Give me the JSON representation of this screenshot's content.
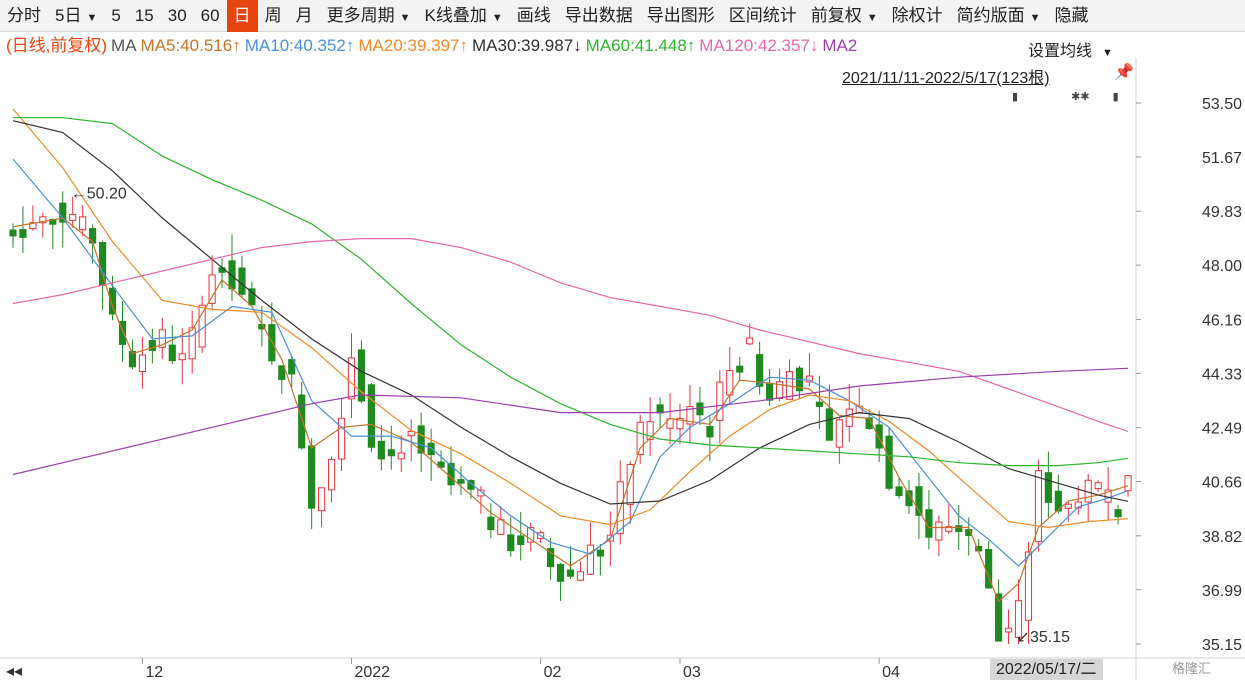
{
  "toolbar": {
    "items": [
      {
        "label": "分时",
        "dropdown": false,
        "active": false
      },
      {
        "label": "5日",
        "dropdown": true,
        "active": false
      },
      {
        "label": "5",
        "dropdown": false,
        "active": false
      },
      {
        "label": "15",
        "dropdown": false,
        "active": false
      },
      {
        "label": "30",
        "dropdown": false,
        "active": false
      },
      {
        "label": "60",
        "dropdown": false,
        "active": false
      },
      {
        "label": "日",
        "dropdown": false,
        "active": true
      },
      {
        "label": "周",
        "dropdown": false,
        "active": false
      },
      {
        "label": "月",
        "dropdown": false,
        "active": false
      },
      {
        "label": "更多周期",
        "dropdown": true,
        "active": false
      },
      {
        "label": "K线叠加",
        "dropdown": true,
        "active": false
      },
      {
        "label": "画线",
        "dropdown": false,
        "active": false
      },
      {
        "label": "导出数据",
        "dropdown": false,
        "active": false
      },
      {
        "label": "导出图形",
        "dropdown": false,
        "active": false
      },
      {
        "label": "区间统计",
        "dropdown": false,
        "active": false
      },
      {
        "label": "前复权",
        "dropdown": true,
        "active": false
      },
      {
        "label": "除权计",
        "dropdown": false,
        "active": false
      },
      {
        "label": "简约版面",
        "dropdown": true,
        "active": false
      },
      {
        "label": "隐藏",
        "dropdown": false,
        "active": false
      }
    ]
  },
  "legend": [
    {
      "text": "(日线,前复权)",
      "color": "#e6450f"
    },
    {
      "text": "MA",
      "color": "#555555"
    },
    {
      "text": "MA5:40.516↑",
      "color": "#c8742a"
    },
    {
      "text": "MA10:40.352↑",
      "color": "#4a90d9"
    },
    {
      "text": "MA20:39.397↑",
      "color": "#f08c28"
    },
    {
      "text": "MA30:39.987↓",
      "color": "#333333"
    },
    {
      "text": "MA60:41.448↑",
      "color": "#2db52d"
    },
    {
      "text": "MA120:42.357↓",
      "color": "#e868a8"
    },
    {
      "text": "MA2",
      "color": "#9b3fae"
    }
  ],
  "settings_label": "设置均线",
  "range_label": "2021/11/11-2022/5/17(123根)",
  "pin_icon": "pushpin-icon",
  "date_badge": "2022/05/17/二",
  "watermark": "格隆汇",
  "colors": {
    "up": "#e8333a",
    "down": "#1f8a1f",
    "ma5": "#c8742a",
    "ma10": "#4a90d9",
    "ma20": "#f08c28",
    "ma30": "#333333",
    "ma60": "#2db52d",
    "ma120": "#e868a8",
    "ma250": "#9b3fae"
  },
  "chart_data": {
    "type": "candlestick",
    "y_ticks": [
      "53.50",
      "51.67",
      "49.83",
      "48.00",
      "46.16",
      "44.33",
      "42.49",
      "40.66",
      "38.82",
      "36.99",
      "35.15"
    ],
    "ylim": [
      35.15,
      53.5
    ],
    "x_ticks": [
      {
        "label": "12",
        "index": 13
      },
      {
        "label": "2022",
        "index": 34
      },
      {
        "label": "02",
        "index": 53
      },
      {
        "label": "03",
        "index": 67
      },
      {
        "label": "04",
        "index": 87
      }
    ],
    "annotations": [
      {
        "text": "50.20",
        "index": 5,
        "value": 50.2,
        "pointer": "←"
      },
      {
        "text": "35.15",
        "index": 100,
        "value": 35.15,
        "pointer": "↙"
      }
    ],
    "bar_count": 113,
    "trend": [
      [
        0,
        49.2
      ],
      [
        5,
        49.8
      ],
      [
        8,
        48.9
      ],
      [
        10,
        46.0
      ],
      [
        12,
        44.8
      ],
      [
        15,
        45.5
      ],
      [
        17,
        44.5
      ],
      [
        19,
        46.8
      ],
      [
        21,
        48.2
      ],
      [
        24,
        46.3
      ],
      [
        26,
        45.0
      ],
      [
        28,
        44.0
      ],
      [
        30,
        40.0
      ],
      [
        32,
        41.5
      ],
      [
        34,
        45.0
      ],
      [
        36,
        42.2
      ],
      [
        38,
        41.5
      ],
      [
        40,
        42.2
      ],
      [
        42,
        41.2
      ],
      [
        44,
        40.5
      ],
      [
        46,
        40.2
      ],
      [
        48,
        39.3
      ],
      [
        50,
        38.6
      ],
      [
        52,
        38.8
      ],
      [
        54,
        38.0
      ],
      [
        56,
        37.4
      ],
      [
        58,
        38.3
      ],
      [
        60,
        39.0
      ],
      [
        62,
        41.5
      ],
      [
        64,
        43.0
      ],
      [
        66,
        42.6
      ],
      [
        68,
        43.3
      ],
      [
        70,
        42.5
      ],
      [
        72,
        44.8
      ],
      [
        74,
        45.0
      ],
      [
        76,
        43.4
      ],
      [
        78,
        44.4
      ],
      [
        80,
        43.8
      ],
      [
        82,
        42.0
      ],
      [
        84,
        43.3
      ],
      [
        86,
        42.8
      ],
      [
        88,
        40.8
      ],
      [
        90,
        40.2
      ],
      [
        92,
        38.9
      ],
      [
        95,
        39.3
      ],
      [
        97,
        38.4
      ],
      [
        99,
        35.3
      ],
      [
        101,
        36.2
      ],
      [
        103,
        40.7
      ],
      [
        105,
        39.8
      ],
      [
        107,
        40.2
      ],
      [
        109,
        40.4
      ],
      [
        111,
        39.9
      ],
      [
        112,
        41.3
      ]
    ],
    "ma_series": [
      {
        "key": "ma5",
        "values": [
          [
            0,
            49.3
          ],
          [
            5,
            49.6
          ],
          [
            8,
            48.8
          ],
          [
            10,
            46.6
          ],
          [
            12,
            45.0
          ],
          [
            15,
            45.3
          ],
          [
            18,
            45.8
          ],
          [
            21,
            47.5
          ],
          [
            24,
            46.6
          ],
          [
            27,
            44.8
          ],
          [
            30,
            41.8
          ],
          [
            33,
            42.5
          ],
          [
            36,
            42.6
          ],
          [
            40,
            42.0
          ],
          [
            44,
            40.8
          ],
          [
            48,
            39.6
          ],
          [
            52,
            38.7
          ],
          [
            56,
            37.8
          ],
          [
            60,
            38.7
          ],
          [
            63,
            41.8
          ],
          [
            66,
            42.8
          ],
          [
            70,
            42.6
          ],
          [
            73,
            44.1
          ],
          [
            76,
            44.0
          ],
          [
            80,
            43.8
          ],
          [
            83,
            42.9
          ],
          [
            86,
            42.8
          ],
          [
            89,
            40.8
          ],
          [
            92,
            39.1
          ],
          [
            96,
            39.1
          ],
          [
            99,
            36.6
          ],
          [
            101,
            37.2
          ],
          [
            103,
            39.1
          ],
          [
            106,
            40.0
          ],
          [
            109,
            40.2
          ],
          [
            112,
            40.52
          ]
        ]
      },
      {
        "key": "ma10",
        "values": [
          [
            0,
            51.6
          ],
          [
            5,
            49.6
          ],
          [
            10,
            47.3
          ],
          [
            14,
            45.5
          ],
          [
            18,
            45.6
          ],
          [
            22,
            46.6
          ],
          [
            26,
            46.4
          ],
          [
            30,
            43.4
          ],
          [
            34,
            42.2
          ],
          [
            38,
            42.2
          ],
          [
            42,
            41.8
          ],
          [
            46,
            40.6
          ],
          [
            50,
            39.5
          ],
          [
            54,
            38.6
          ],
          [
            58,
            38.2
          ],
          [
            62,
            39.3
          ],
          [
            65,
            41.5
          ],
          [
            68,
            42.5
          ],
          [
            72,
            43.3
          ],
          [
            76,
            44.2
          ],
          [
            80,
            44.1
          ],
          [
            84,
            43.4
          ],
          [
            88,
            42.5
          ],
          [
            91,
            41.2
          ],
          [
            95,
            39.5
          ],
          [
            98,
            38.7
          ],
          [
            101,
            37.8
          ],
          [
            104,
            38.8
          ],
          [
            107,
            39.8
          ],
          [
            110,
            40.1
          ],
          [
            112,
            40.35
          ]
        ]
      },
      {
        "key": "ma20",
        "values": [
          [
            0,
            53.3
          ],
          [
            5,
            51.3
          ],
          [
            10,
            48.8
          ],
          [
            15,
            46.8
          ],
          [
            20,
            46.5
          ],
          [
            25,
            46.4
          ],
          [
            30,
            45.2
          ],
          [
            35,
            43.7
          ],
          [
            40,
            42.4
          ],
          [
            45,
            41.6
          ],
          [
            50,
            40.6
          ],
          [
            55,
            39.5
          ],
          [
            60,
            39.2
          ],
          [
            64,
            39.7
          ],
          [
            68,
            41.0
          ],
          [
            72,
            42.2
          ],
          [
            76,
            43.1
          ],
          [
            80,
            43.6
          ],
          [
            84,
            43.4
          ],
          [
            88,
            42.7
          ],
          [
            92,
            41.7
          ],
          [
            96,
            40.5
          ],
          [
            100,
            39.3
          ],
          [
            104,
            39.1
          ],
          [
            108,
            39.3
          ],
          [
            112,
            39.4
          ]
        ]
      },
      {
        "key": "ma30",
        "values": [
          [
            0,
            52.9
          ],
          [
            5,
            52.5
          ],
          [
            10,
            51.2
          ],
          [
            15,
            49.6
          ],
          [
            20,
            48.2
          ],
          [
            25,
            46.8
          ],
          [
            30,
            45.5
          ],
          [
            35,
            44.4
          ],
          [
            40,
            43.6
          ],
          [
            45,
            42.5
          ],
          [
            50,
            41.5
          ],
          [
            55,
            40.6
          ],
          [
            60,
            39.9
          ],
          [
            65,
            40.0
          ],
          [
            70,
            40.7
          ],
          [
            75,
            41.8
          ],
          [
            80,
            42.6
          ],
          [
            85,
            43.0
          ],
          [
            90,
            42.8
          ],
          [
            95,
            42.0
          ],
          [
            100,
            41.1
          ],
          [
            105,
            40.6
          ],
          [
            109,
            40.2
          ],
          [
            112,
            39.99
          ]
        ]
      },
      {
        "key": "ma60",
        "values": [
          [
            0,
            53.0
          ],
          [
            5,
            53.0
          ],
          [
            10,
            52.8
          ],
          [
            15,
            51.7
          ],
          [
            20,
            50.9
          ],
          [
            25,
            50.2
          ],
          [
            30,
            49.4
          ],
          [
            35,
            48.2
          ],
          [
            40,
            46.7
          ],
          [
            45,
            45.3
          ],
          [
            50,
            44.2
          ],
          [
            55,
            43.3
          ],
          [
            60,
            42.6
          ],
          [
            65,
            42.1
          ],
          [
            70,
            41.9
          ],
          [
            75,
            41.8
          ],
          [
            80,
            41.7
          ],
          [
            85,
            41.6
          ],
          [
            90,
            41.5
          ],
          [
            95,
            41.3
          ],
          [
            100,
            41.2
          ],
          [
            105,
            41.2
          ],
          [
            109,
            41.3
          ],
          [
            112,
            41.45
          ]
        ]
      },
      {
        "key": "ma120",
        "values": [
          [
            0,
            46.7
          ],
          [
            5,
            47.0
          ],
          [
            10,
            47.4
          ],
          [
            15,
            47.8
          ],
          [
            20,
            48.2
          ],
          [
            25,
            48.6
          ],
          [
            30,
            48.8
          ],
          [
            35,
            48.9
          ],
          [
            40,
            48.9
          ],
          [
            45,
            48.6
          ],
          [
            50,
            48.1
          ],
          [
            55,
            47.4
          ],
          [
            60,
            46.9
          ],
          [
            65,
            46.6
          ],
          [
            70,
            46.3
          ],
          [
            75,
            45.8
          ],
          [
            80,
            45.4
          ],
          [
            85,
            45.0
          ],
          [
            90,
            44.7
          ],
          [
            95,
            44.4
          ],
          [
            100,
            43.8
          ],
          [
            105,
            43.2
          ],
          [
            109,
            42.7
          ],
          [
            112,
            42.36
          ]
        ]
      },
      {
        "key": "ma250",
        "values": [
          [
            0,
            40.9
          ],
          [
            10,
            41.7
          ],
          [
            20,
            42.5
          ],
          [
            30,
            43.3
          ],
          [
            35,
            43.6
          ],
          [
            45,
            43.5
          ],
          [
            55,
            43.0
          ],
          [
            65,
            43.0
          ],
          [
            75,
            43.4
          ],
          [
            85,
            43.9
          ],
          [
            95,
            44.2
          ],
          [
            105,
            44.4
          ],
          [
            112,
            44.5
          ]
        ]
      }
    ]
  }
}
